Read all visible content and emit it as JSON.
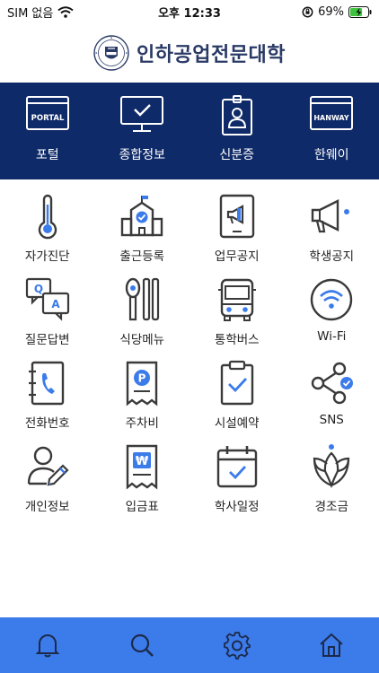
{
  "status_bar": {
    "carrier": "SIM 없음",
    "time": "오후 12:33",
    "battery_percent": "69%",
    "battery_level": 0.69
  },
  "header": {
    "title": "인하공업전문대학"
  },
  "top_nav": [
    {
      "label": "포털",
      "icon_text": "PORTAL",
      "icon": "portal-monitor-icon"
    },
    {
      "label": "종합정보",
      "icon": "checked-monitor-icon"
    },
    {
      "label": "신분증",
      "icon": "id-badge-icon"
    },
    {
      "label": "한웨이",
      "icon_text": "HANWAY",
      "icon": "hanway-monitor-icon"
    }
  ],
  "menu": [
    {
      "label": "자가진단",
      "icon": "thermometer-icon"
    },
    {
      "label": "출근등록",
      "icon": "building-check-icon"
    },
    {
      "label": "업무공지",
      "icon": "megaphone-tablet-icon"
    },
    {
      "label": "학생공지",
      "icon": "megaphone-icon"
    },
    {
      "label": "질문답변",
      "icon": "qa-bubbles-icon"
    },
    {
      "label": "식당메뉴",
      "icon": "cutlery-icon"
    },
    {
      "label": "통학버스",
      "icon": "bus-icon"
    },
    {
      "label": "Wi-Fi",
      "icon": "wifi-icon"
    },
    {
      "label": "전화번호",
      "icon": "phone-book-icon"
    },
    {
      "label": "주차비",
      "icon": "parking-receipt-icon"
    },
    {
      "label": "시설예약",
      "icon": "clipboard-check-icon"
    },
    {
      "label": "SNS",
      "icon": "share-icon"
    },
    {
      "label": "개인정보",
      "icon": "user-edit-icon"
    },
    {
      "label": "입금표",
      "icon": "won-receipt-icon"
    },
    {
      "label": "학사일정",
      "icon": "calendar-check-icon"
    },
    {
      "label": "경조금",
      "icon": "flower-icon"
    }
  ],
  "tab_bar": [
    {
      "icon": "bell-icon"
    },
    {
      "icon": "search-icon"
    },
    {
      "icon": "gear-icon"
    },
    {
      "icon": "home-icon"
    }
  ],
  "colors": {
    "navy": "#0f2a68",
    "accent_blue": "#3b7bea",
    "icon_stroke": "#3a3a3a",
    "tab_bar": "#3b7bea"
  }
}
